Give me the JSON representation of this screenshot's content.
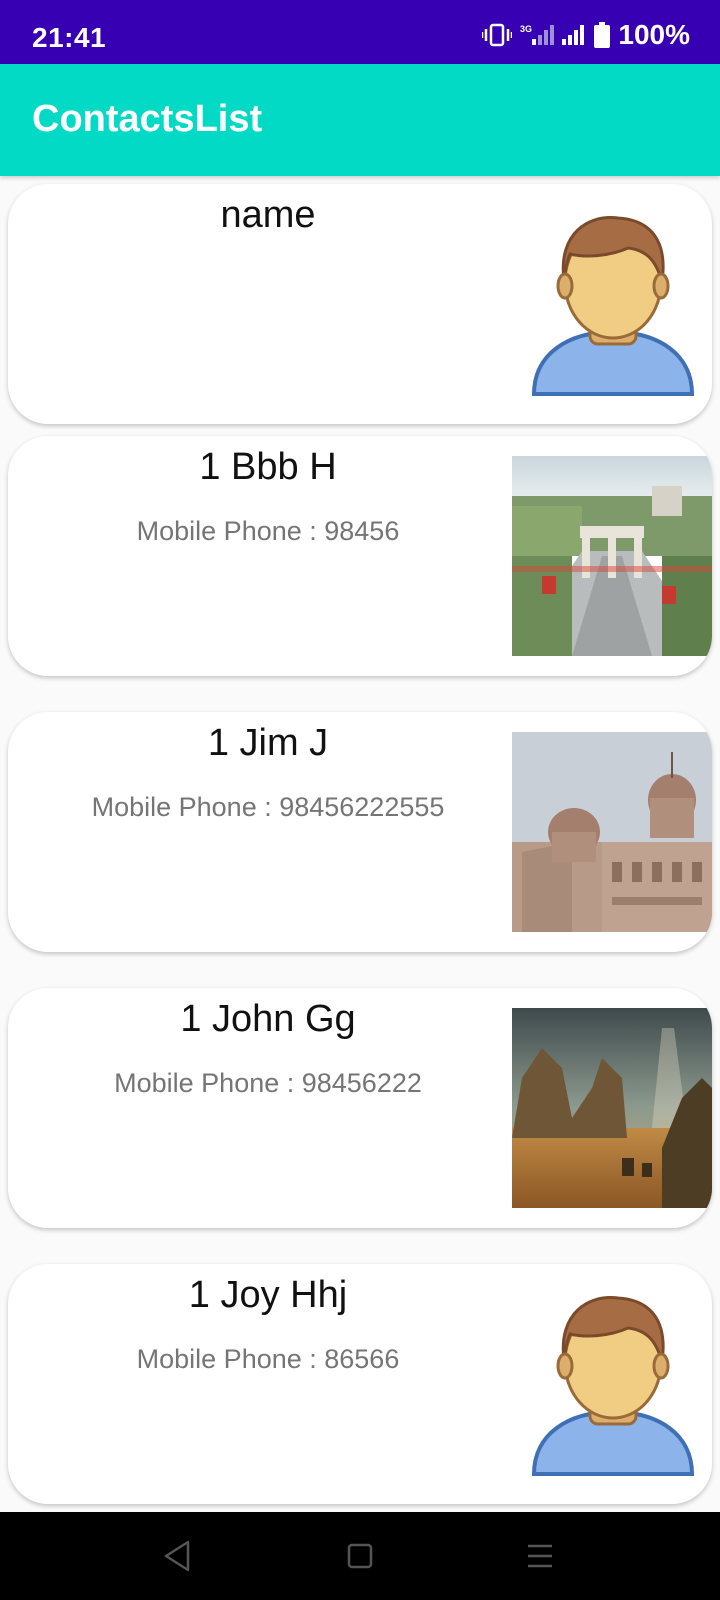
{
  "status_bar": {
    "time": "21:41",
    "battery": "100%",
    "icons": [
      "vibrate-icon",
      "signal-3g-icon",
      "signal-icon",
      "battery-icon"
    ]
  },
  "app_bar": {
    "title": "ContactsList",
    "color": "#03dac5"
  },
  "contacts": [
    {
      "name": "name",
      "phone": "",
      "image": "default-avatar"
    },
    {
      "name": "1 Bbb H",
      "phone": "Mobile Phone : 98456",
      "image": "city-photo"
    },
    {
      "name": "1 Jim J",
      "phone": "Mobile Phone : 98456222555",
      "image": "palace-photo"
    },
    {
      "name": "1 John Gg",
      "phone": "Mobile Phone : 98456222",
      "image": "desert-photo"
    },
    {
      "name": "1 Joy Hhj",
      "phone": "Mobile Phone : 86566",
      "image": "default-avatar"
    }
  ],
  "nav_bar": {
    "buttons": [
      "back-icon",
      "home-icon",
      "menu-icon"
    ]
  },
  "colors": {
    "status_bar": "#3700b3",
    "app_bar": "#03dac5",
    "phone_text": "#757575"
  }
}
